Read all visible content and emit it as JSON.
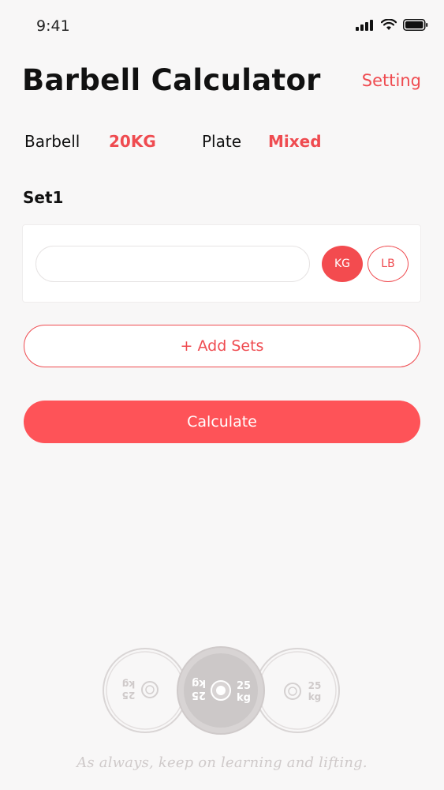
{
  "status_bar": {
    "time": "9:41",
    "icons": [
      "cellular-signal-icon",
      "wifi-icon",
      "battery-icon"
    ]
  },
  "header": {
    "title": "Barbell Calculator",
    "setting_label": "Setting"
  },
  "config": {
    "barbell_label": "Barbell",
    "barbell_value": "20KG",
    "plate_label": "Plate",
    "plate_value": "Mixed"
  },
  "sets": [
    {
      "label": "Set1",
      "weight_value": "",
      "weight_placeholder": "",
      "units": {
        "kg": "KG",
        "lb": "LB",
        "selected": "KG"
      }
    }
  ],
  "actions": {
    "add_sets_label": "+ Add Sets",
    "calculate_label": "Calculate"
  },
  "footer": {
    "plate_text": {
      "value": "25",
      "unit": "kg"
    },
    "motto": "As always, keep on learning and lifting."
  },
  "colors": {
    "accent": "#ef4b50",
    "button_fill": "#fe5358",
    "background": "#f8f7f7",
    "card": "#ffffff"
  }
}
